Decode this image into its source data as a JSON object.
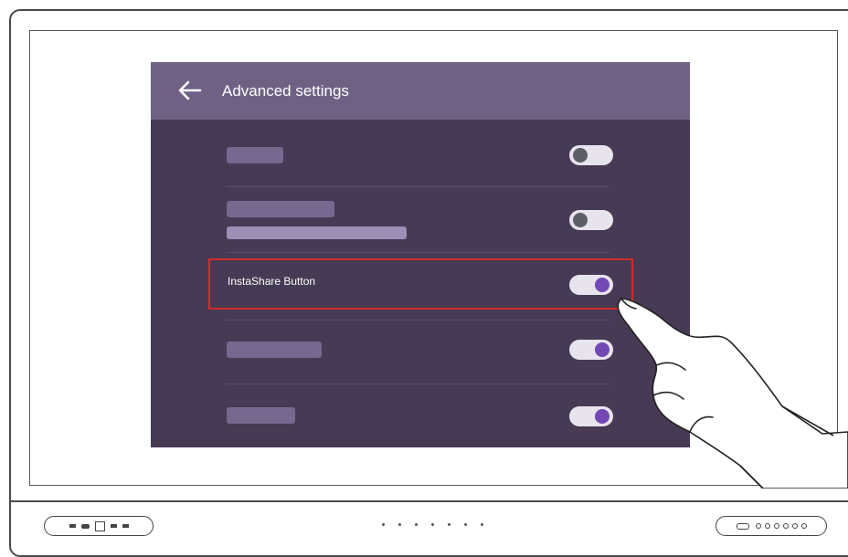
{
  "header": {
    "title": "Advanced settings"
  },
  "rows": [
    {
      "label": "",
      "toggle": "off"
    },
    {
      "label": "",
      "toggle": "off"
    },
    {
      "label": "InstaShare Button",
      "toggle": "on",
      "highlighted": true
    },
    {
      "label": "",
      "toggle": "on"
    },
    {
      "label": "",
      "toggle": "on"
    }
  ],
  "colors": {
    "header_bg": "#6e6184",
    "panel_bg": "#463a54",
    "toggle_on_knob": "#7348b5",
    "toggle_off_knob": "#5e5e66",
    "highlight_border": "#d42a2a"
  },
  "icons": {
    "back": "arrow-left-icon",
    "pointer": "hand-pointer-icon"
  }
}
